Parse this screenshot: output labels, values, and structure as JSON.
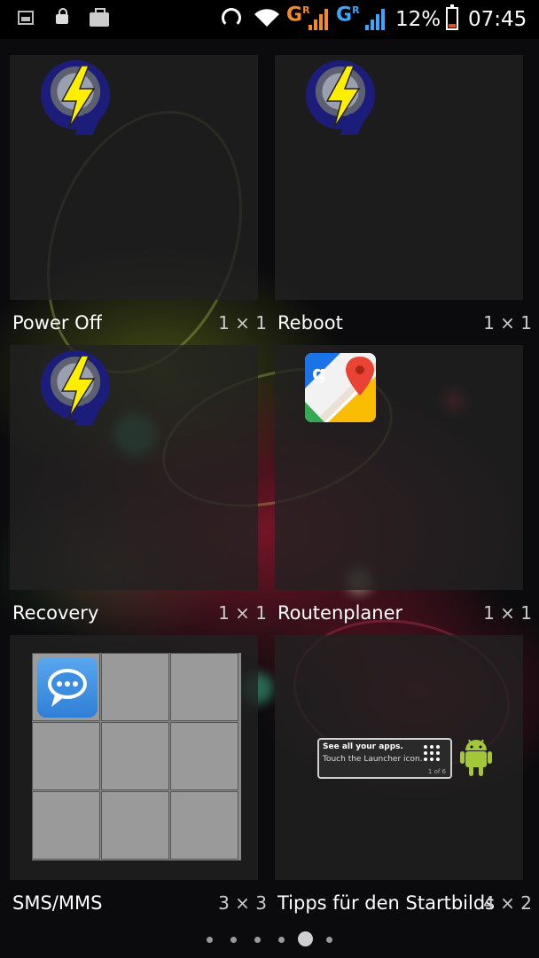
{
  "status_bar": {
    "icons": [
      "gallery-icon",
      "lock-icon",
      "briefcase-icon",
      "headset-icon",
      "wifi-icon"
    ],
    "network_1": "G",
    "network_1_sub": "R",
    "network_2": "G",
    "network_2_sub": "R",
    "network_1_color": "#f28c28",
    "network_2_color": "#3ea6ff",
    "battery_percent": "12%",
    "battery_level": 0.12,
    "time": "07:45"
  },
  "widgets": [
    {
      "name": "Power Off",
      "size": "1 × 1",
      "icon": "flash-icon"
    },
    {
      "name": "Reboot",
      "size": "1 × 1",
      "icon": "flash-icon"
    },
    {
      "name": "Recovery",
      "size": "1 × 1",
      "icon": "flash-icon"
    },
    {
      "name": "Routenplaner",
      "size": "1 × 1",
      "icon": "google-maps-icon"
    },
    {
      "name": "SMS/MMS",
      "size": "3 × 3",
      "icon": "sms-icon"
    },
    {
      "name": "Tipps für den Startbildschirm",
      "size": "4 × 2",
      "icon": "android-icon"
    }
  ],
  "tips_widget": {
    "line1": "See all your apps.",
    "line2": "Touch the Launcher icon.",
    "page": "1 of 6"
  },
  "pager": {
    "total": 6,
    "active_index": 4
  }
}
